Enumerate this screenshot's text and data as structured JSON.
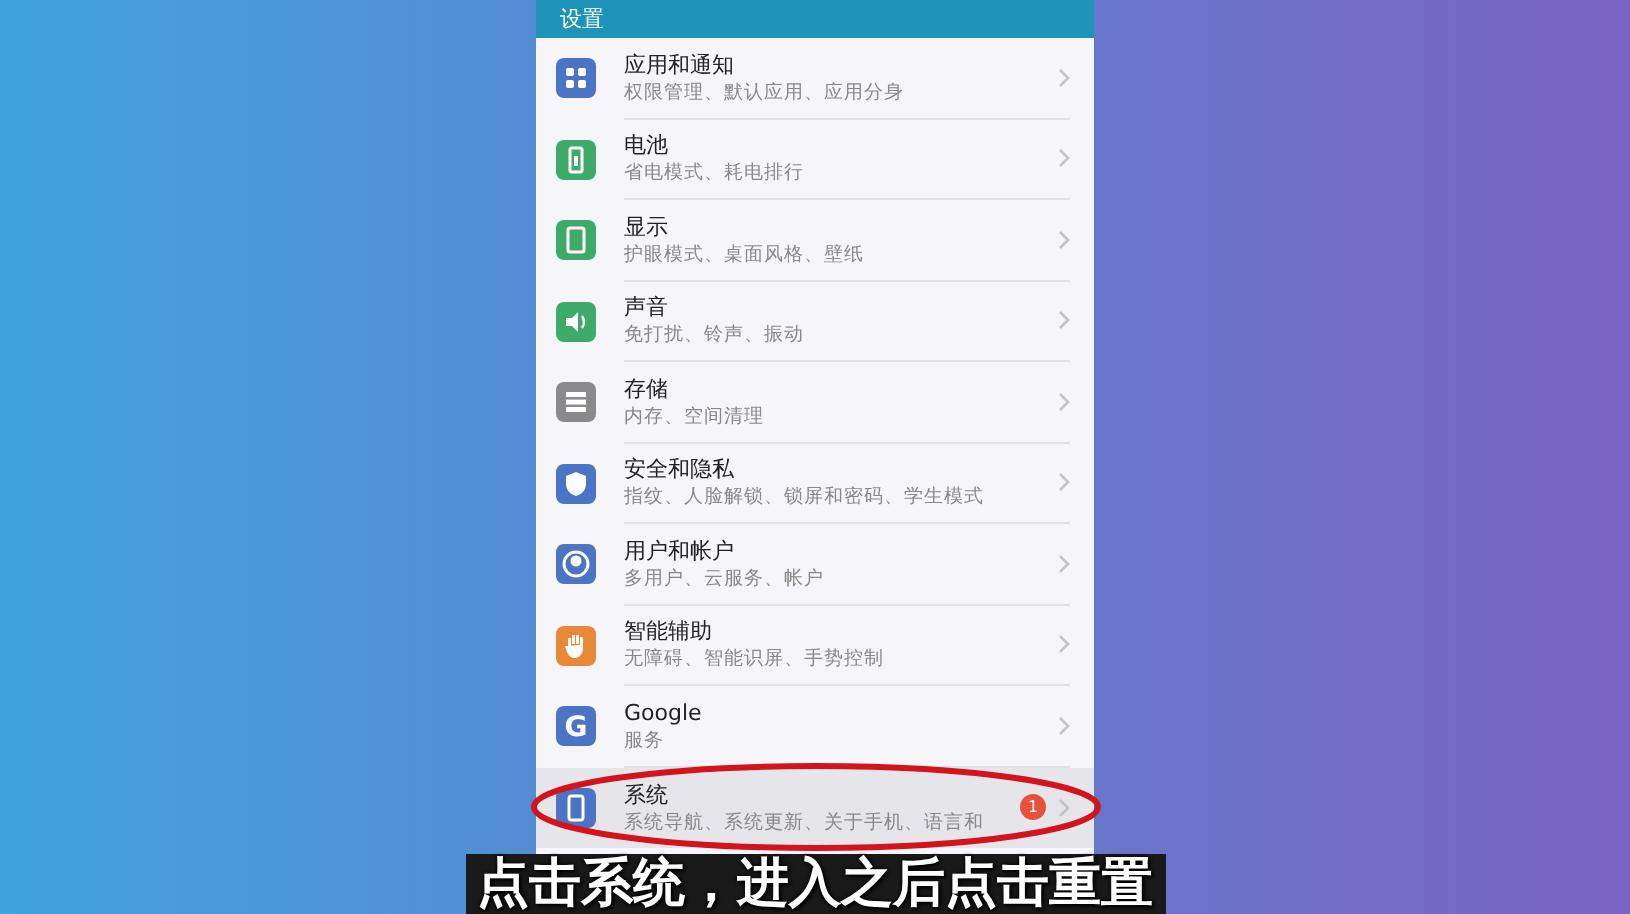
{
  "header": {
    "title": "设置"
  },
  "items": [
    {
      "title": "应用和通知",
      "subtitle": "权限管理、默认应用、应用分身",
      "color": "#4b74c4",
      "selected": false
    },
    {
      "title": "电池",
      "subtitle": "省电模式、耗电排行",
      "color": "#3daa6a",
      "selected": false
    },
    {
      "title": "显示",
      "subtitle": "护眼模式、桌面风格、壁纸",
      "color": "#3daa6a",
      "selected": false
    },
    {
      "title": "声音",
      "subtitle": "免打扰、铃声、振动",
      "color": "#3daa6a",
      "selected": false
    },
    {
      "title": "存储",
      "subtitle": "内存、空间清理",
      "color": "#8a8a8e",
      "selected": false
    },
    {
      "title": "安全和隐私",
      "subtitle": "指纹、人脸解锁、锁屏和密码、学生模式",
      "color": "#4b74c4",
      "selected": false
    },
    {
      "title": "用户和帐户",
      "subtitle": "多用户、云服务、帐户",
      "color": "#4b74c4",
      "selected": false
    },
    {
      "title": "智能辅助",
      "subtitle": "无障碍、智能识屏、手势控制",
      "color": "#e8893a",
      "selected": false
    },
    {
      "title": "Google",
      "subtitle": "服务",
      "color": "#4b74c4",
      "selected": false,
      "icon_text": "G"
    },
    {
      "title": "系统",
      "subtitle": "系统导航、系统更新、关于手机、语言和",
      "color": "#4b74c4",
      "selected": true,
      "badge": "1"
    }
  ],
  "caption": "点击系统，进入之后点击重置"
}
